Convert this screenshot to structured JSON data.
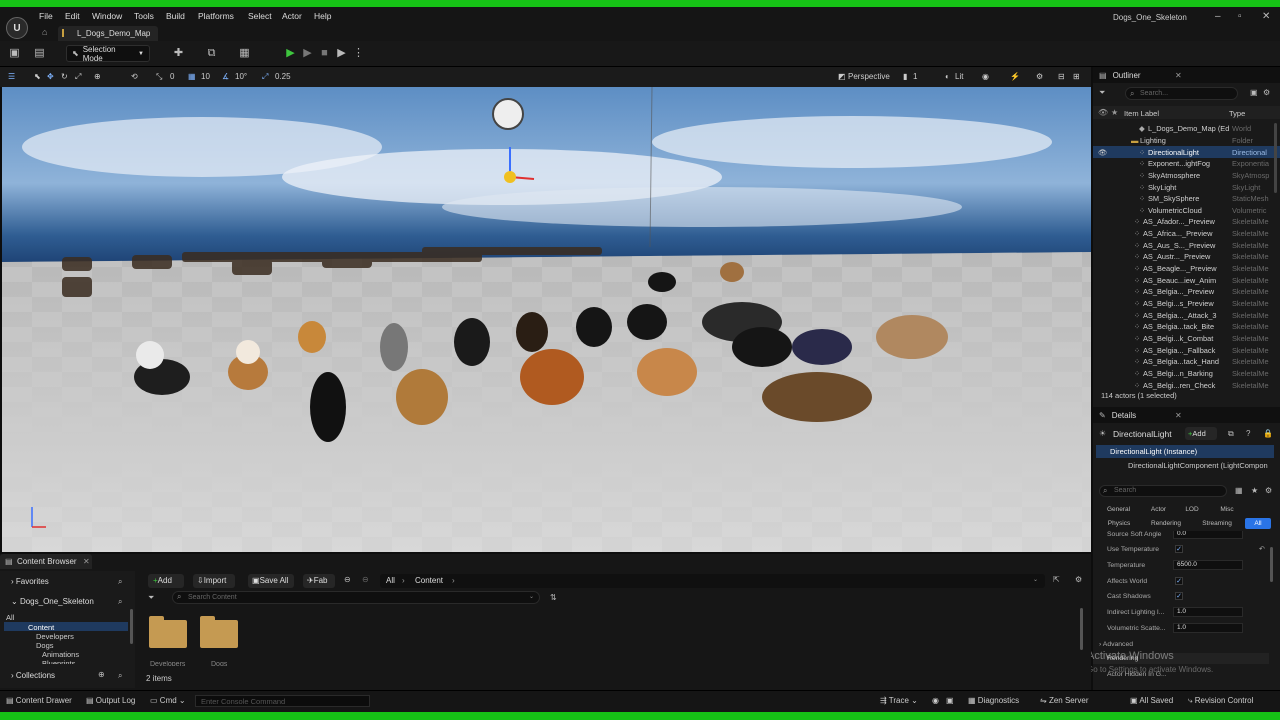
{
  "app": {
    "project_title": "Dogs_One_Skeleton",
    "map_tab": "L_Dogs_Demo_Map"
  },
  "menu": [
    "File",
    "Edit",
    "Window",
    "Tools",
    "Build",
    "Platforms",
    "Select",
    "Actor",
    "Help"
  ],
  "toolbar": {
    "mode": "Selection Mode"
  },
  "viewport_bar": {
    "snap_move": "0",
    "snap_grid": "10",
    "snap_angle": "10°",
    "snap_scale": "0.25",
    "view": "Perspective",
    "camera_speed": "1",
    "lit": "Lit"
  },
  "outliner": {
    "title": "Outliner",
    "search_placeholder": "Search...",
    "col_label": "Item Label",
    "col_type": "Type",
    "rows": [
      {
        "label": "L_Dogs_Demo_Map (Ed",
        "type": "World"
      },
      {
        "label": "Lighting",
        "type": "Folder"
      },
      {
        "label": "DirectionalLight",
        "type": "Directional"
      },
      {
        "label": "Exponent...ightFog",
        "type": "Exponentia"
      },
      {
        "label": "SkyAtmosphere",
        "type": "SkyAtmosp"
      },
      {
        "label": "SkyLight",
        "type": "SkyLight"
      },
      {
        "label": "SM_SkySphere",
        "type": "StaticMesh"
      },
      {
        "label": "VolumetricCloud",
        "type": "Volumetric"
      },
      {
        "label": "AS_Afador..._Preview",
        "type": "SkeletalMe"
      },
      {
        "label": "AS_Africa..._Preview",
        "type": "SkeletalMe"
      },
      {
        "label": "AS_Aus_S..._Preview",
        "type": "SkeletalMe"
      },
      {
        "label": "AS_Austr..._Preview",
        "type": "SkeletalMe"
      },
      {
        "label": "AS_Beagle..._Preview",
        "type": "SkeletalMe"
      },
      {
        "label": "AS_Beauc...iew_Anim",
        "type": "SkeletalMe"
      },
      {
        "label": "AS_Belgia..._Preview",
        "type": "SkeletalMe"
      },
      {
        "label": "AS_Belgi...s_Preview",
        "type": "SkeletalMe"
      },
      {
        "label": "AS_Belgia..._Attack_3",
        "type": "SkeletalMe"
      },
      {
        "label": "AS_Belgia...tack_Bite",
        "type": "SkeletalMe"
      },
      {
        "label": "AS_Belgi...k_Combat",
        "type": "SkeletalMe"
      },
      {
        "label": "AS_Belgia..._Fallback",
        "type": "SkeletalMe"
      },
      {
        "label": "AS_Belgia...tack_Hand",
        "type": "SkeletalMe"
      },
      {
        "label": "AS_Belgi...n_Barking",
        "type": "SkeletalMe"
      },
      {
        "label": "AS_Belgi...ren_Check",
        "type": "SkeletalMe"
      }
    ],
    "footer": "114 actors (1 selected)"
  },
  "details": {
    "title": "Details",
    "actor_name": "DirectionalLight",
    "add_label": "Add",
    "instance": "DirectionalLight (Instance)",
    "component": "DirectionalLightComponent (LightCompon",
    "search_placeholder": "Search",
    "filters_row1": [
      "General",
      "Actor",
      "LOD",
      "Misc"
    ],
    "filters_row2": [
      "Physics",
      "Rendering",
      "Streaming",
      "All"
    ],
    "props": [
      {
        "label": "Source Soft Angle",
        "value": "0.0"
      },
      {
        "label": "Use Temperature",
        "value": ""
      },
      {
        "label": "Temperature",
        "value": "6500.0"
      },
      {
        "label": "Affects World",
        "value": ""
      },
      {
        "label": "Cast Shadows",
        "value": ""
      },
      {
        "label": "Indirect Lighting I...",
        "value": "1.0"
      },
      {
        "label": "Volumetric Scatte...",
        "value": "1.0"
      }
    ],
    "advanced": "Advanced",
    "section": "Rendering",
    "hidden": "Actor Hidden In G..."
  },
  "watermark": {
    "line1": "Activate Windows",
    "line2": "Go to Settings to activate Windows."
  },
  "content_browser": {
    "tab": "Content Browser",
    "add": "Add",
    "import": "Import",
    "save_all": "Save All",
    "fab": "Fab",
    "path": [
      "All",
      "Content"
    ],
    "search_placeholder": "Search Content",
    "favorites": "Favorites",
    "project": "Dogs_One_Skeleton",
    "collections": "Collections",
    "tree": [
      "All",
      "Content",
      "Developers",
      "Dogs",
      "Animations",
      "Blueprints"
    ],
    "folders": [
      "Developers",
      "Dogs"
    ],
    "count": "2 items"
  },
  "status": {
    "content_drawer": "Content Drawer",
    "output_log": "Output Log",
    "cmd": "Cmd",
    "console_placeholder": "Enter Console Command",
    "trace": "Trace",
    "diagnostics": "Diagnostics",
    "zen": "Zen Server",
    "saved": "All Saved",
    "revision": "Revision Control"
  }
}
